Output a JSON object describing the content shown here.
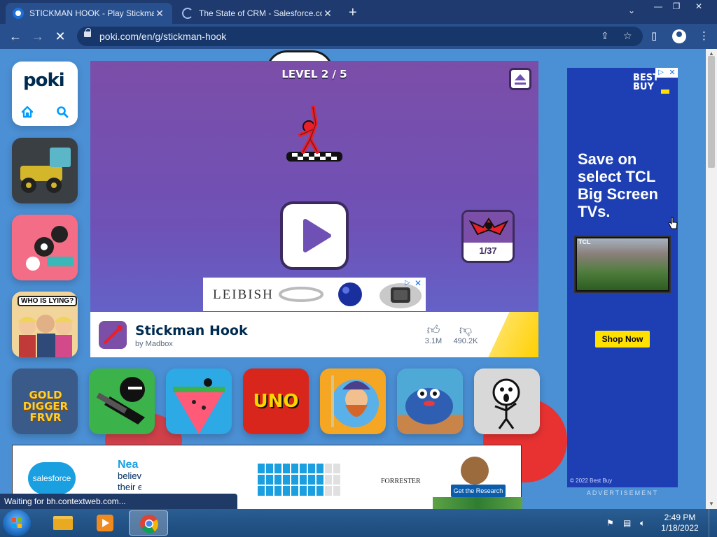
{
  "browser": {
    "tabs": [
      {
        "title": "STICKMAN HOOK - Play Stickman",
        "active": true
      },
      {
        "title": "The State of CRM - Salesforce.co",
        "active": false
      }
    ],
    "new_tab_symbol": "+",
    "tab_search_symbol": "⌄",
    "url": "poki.com/en/g/stickman-hook",
    "window_controls": {
      "minimize": "—",
      "maximize": "❐",
      "close": "✕"
    },
    "nav": {
      "back": "←",
      "forward": "→",
      "stop": "✕"
    },
    "icons": {
      "share": "share-icon",
      "bookmark": "star-icon",
      "sidebar": "side-panel-icon",
      "profile": "profile-icon",
      "menu": "kebab-menu-icon"
    }
  },
  "site": {
    "logo_text": "poki",
    "nav_icons": [
      "home-icon",
      "search-icon"
    ],
    "left_tiles": [
      {
        "name": "Monster truck game",
        "bg": "#3a3f44"
      },
      {
        "name": "Spinner game",
        "bg": "#f46d86"
      },
      {
        "name": "Who Is Lying",
        "label": "WHO IS LYING?",
        "bg": "#f2d59b"
      },
      {
        "name": "Gold Digger FRVR",
        "label": "GOLD DIGGER FRVR",
        "bg": "#3a5b8a"
      }
    ],
    "bottom_tiles": [
      {
        "name": "Stickman shooter",
        "bg": "#3bb34a"
      },
      {
        "name": "Watermelon game",
        "bg": "#2da9e6"
      },
      {
        "name": "UNO",
        "label": "UNO",
        "bg": "#d9261c"
      },
      {
        "name": "Lumberjack game",
        "bg": "#f5a623"
      },
      {
        "name": "Blob game",
        "bg": "#4fa9d6"
      },
      {
        "name": "Stickman face game",
        "bg": "#d8d8d8"
      }
    ]
  },
  "game": {
    "level_text": "LEVEL 2 / 5",
    "level_progress": "1/37",
    "play_icon": "play-icon",
    "collapse_icon": "eject-icon",
    "ad": {
      "brand": "LEIBISH",
      "ad_choice": "▷",
      "close": "✕"
    },
    "title": "Stickman Hook",
    "author": "by Madbox",
    "likes": "3.1M",
    "dislikes": "490.2K",
    "like_icon": "thumbs-up-icon",
    "dislike_icon": "thumbs-down-icon"
  },
  "side_ad": {
    "brand": "BEST BUY",
    "headline_lines": [
      "Save on",
      "select TCL",
      "Big Screen",
      "TVs."
    ],
    "tv_brand": "TCL",
    "cta": "Shop Now",
    "footer": "© 2022 Best Buy",
    "label": "ADVERTISEMENT",
    "ad_choice": "▷",
    "close": "✕",
    "colors": {
      "bg": "#1d3fb3",
      "accent": "#ffe000"
    }
  },
  "banner_ad": {
    "brand": "salesforce",
    "text_lines": [
      "Nea",
      "believ",
      "their e"
    ],
    "partner": "FORRESTER",
    "cta": "Get the Research"
  },
  "status_text": "Waiting for bh.contextweb.com...",
  "taskbar": {
    "time": "2:49 PM",
    "date": "1/18/2022",
    "items": [
      "file-explorer-icon",
      "media-player-icon",
      "chrome-icon"
    ],
    "tray": [
      "flag-icon",
      "network-icon",
      "volume-icon"
    ]
  }
}
